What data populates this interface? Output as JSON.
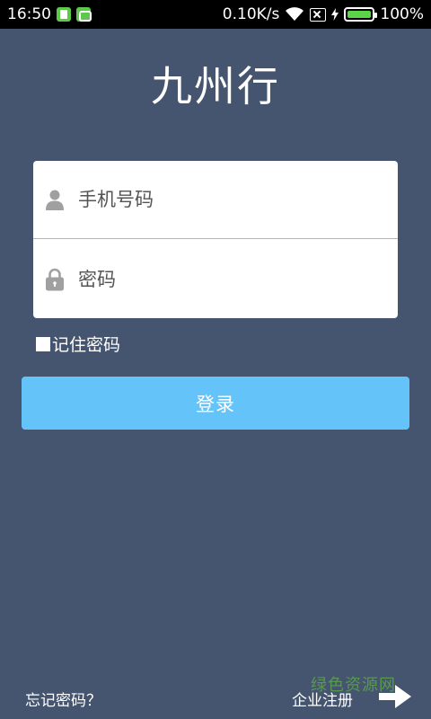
{
  "status_bar": {
    "time": "16:50",
    "speed": "0.10K/s",
    "battery": "100%",
    "battery_level": 1.0
  },
  "app": {
    "title": "九州行"
  },
  "form": {
    "phone_placeholder": "手机号码",
    "password_placeholder": "密码",
    "remember_label": "记住密码",
    "login_button": "登录"
  },
  "footer": {
    "forgot_password": "忘记密码？",
    "enterprise_register": "企业注册"
  },
  "watermark": "绿色资源网",
  "colors": {
    "background": "#45546f",
    "button": "#64c4fa",
    "card": "#ffffff"
  },
  "icons": {
    "phone_field": "person-icon",
    "password_field": "lock-icon",
    "register": "arrow-right-icon"
  }
}
